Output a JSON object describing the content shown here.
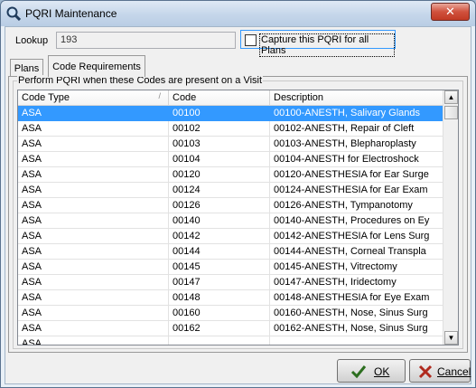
{
  "window": {
    "title": "PQRI Maintenance",
    "close_glyph": "✕"
  },
  "lookup": {
    "label": "Lookup",
    "value": "193"
  },
  "capture": {
    "label": "Capture this PQRI for all Plans",
    "checked": false
  },
  "tabs": [
    {
      "label": "Plans",
      "active": false
    },
    {
      "label": "Code Requirements",
      "active": true
    }
  ],
  "group": {
    "legend": "Perform PQRI when these Codes are present on a Visit"
  },
  "grid": {
    "columns": [
      "Code Type",
      "Code",
      "Description"
    ],
    "sort_glyph": "/",
    "rows": [
      {
        "type": "ASA",
        "code": "00100",
        "description": "00100-ANESTH, Salivary Glands",
        "selected": true
      },
      {
        "type": "ASA",
        "code": "00102",
        "description": "00102-ANESTH, Repair of Cleft"
      },
      {
        "type": "ASA",
        "code": "00103",
        "description": "00103-ANESTH, Blepharoplasty"
      },
      {
        "type": "ASA",
        "code": "00104",
        "description": "00104-ANESTH for Electroshock"
      },
      {
        "type": "ASA",
        "code": "00120",
        "description": "00120-ANESTHESIA for Ear Surge"
      },
      {
        "type": "ASA",
        "code": "00124",
        "description": "00124-ANESTHESIA for Ear Exam"
      },
      {
        "type": "ASA",
        "code": "00126",
        "description": "00126-ANESTH, Tympanotomy"
      },
      {
        "type": "ASA",
        "code": "00140",
        "description": "00140-ANESTH, Procedures on Ey"
      },
      {
        "type": "ASA",
        "code": "00142",
        "description": "00142-ANESTHESIA for Lens Surg"
      },
      {
        "type": "ASA",
        "code": "00144",
        "description": "00144-ANESTH, Corneal Transpla"
      },
      {
        "type": "ASA",
        "code": "00145",
        "description": "00145-ANESTH, Vitrectomy"
      },
      {
        "type": "ASA",
        "code": "00147",
        "description": "00147-ANESTH, Iridectomy"
      },
      {
        "type": "ASA",
        "code": "00148",
        "description": "00148-ANESTHESIA for Eye Exam"
      },
      {
        "type": "ASA",
        "code": "00160",
        "description": "00160-ANESTH, Nose, Sinus Surg"
      },
      {
        "type": "ASA",
        "code": "00162",
        "description": "00162-ANESTH, Nose, Sinus Surg"
      },
      {
        "type": "ASA",
        "code": "",
        "description": ""
      }
    ]
  },
  "buttons": {
    "ok": {
      "label": "OK",
      "icon": "checkmark-icon"
    },
    "cancel": {
      "label": "Cancel",
      "icon": "x-icon"
    }
  },
  "colors": {
    "selection": "#3399ff",
    "focus_border": "#3399ff"
  }
}
